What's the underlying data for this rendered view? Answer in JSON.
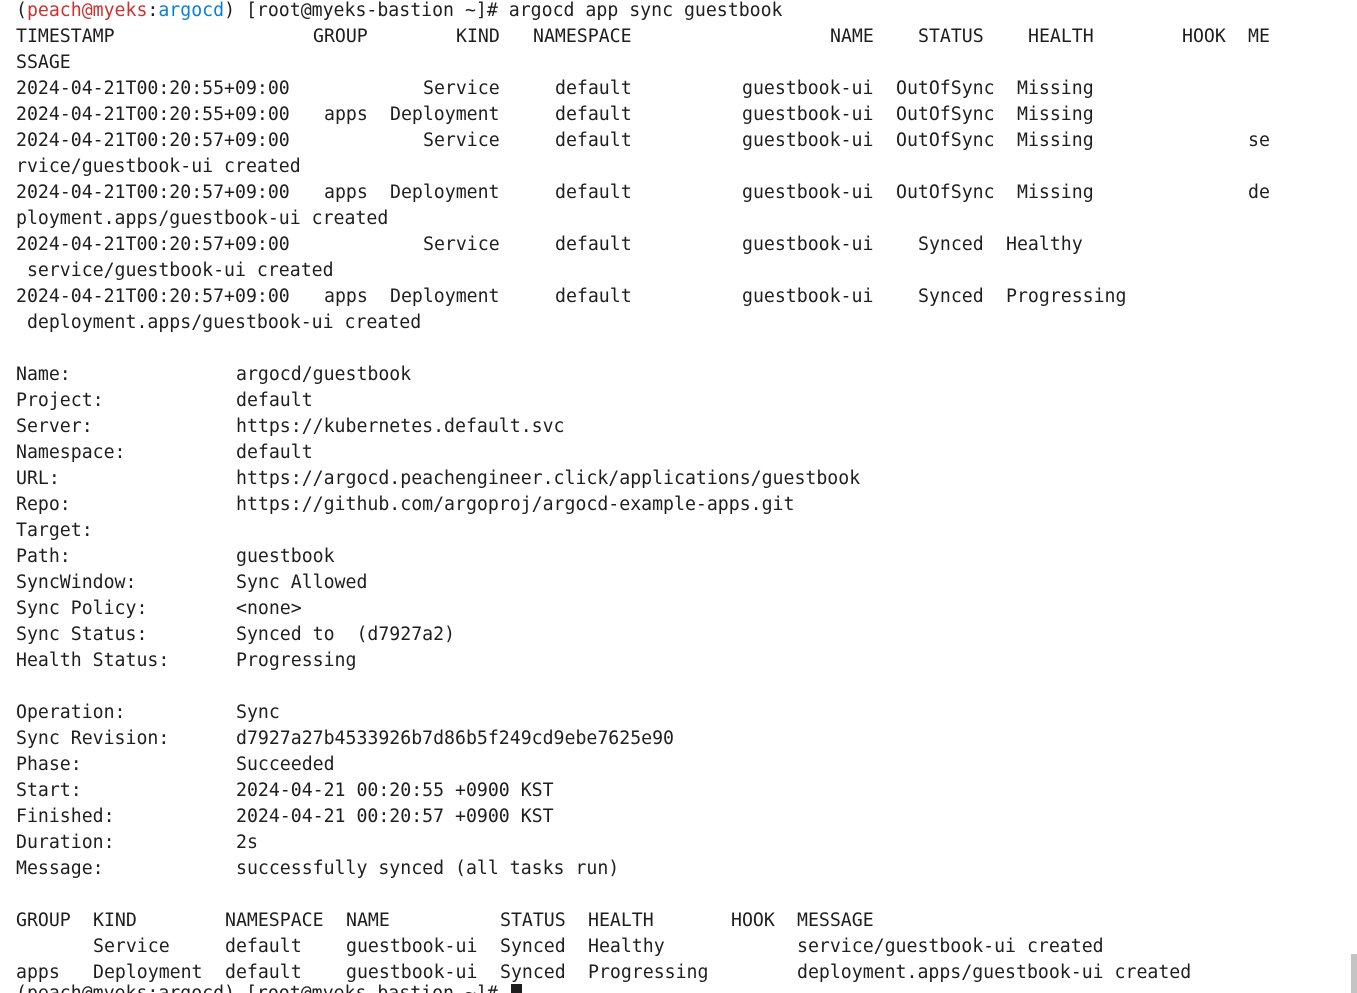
{
  "prompt": {
    "open_paren": "(",
    "user": "peach@myeks",
    "colon": ":",
    "context": "argocd",
    "rest": ") [root@myeks-bastion ~]# ",
    "command": "argocd app sync guestbook",
    "partial_next": "(peach@myeks:argocd) [root@myeks-bastion ~]# "
  },
  "sync_log": {
    "headers": [
      "TIMESTAMP",
      "GROUP",
      "KIND",
      "NAMESPACE",
      "NAME",
      "STATUS",
      "HEALTH",
      "HOOK",
      "ME"
    ],
    "header_wrap": "SSAGE",
    "rows": [
      {
        "timestamp": "2024-04-21T00:20:55+09:00",
        "group": "",
        "kind": "Service",
        "namespace": "default",
        "name": "guestbook-ui",
        "status": "OutOfSync",
        "health": "Missing",
        "message": "",
        "wrap": ""
      },
      {
        "timestamp": "2024-04-21T00:20:55+09:00",
        "group": "apps",
        "kind": "Deployment",
        "namespace": "default",
        "name": "guestbook-ui",
        "status": "OutOfSync",
        "health": "Missing",
        "message": "",
        "wrap": ""
      },
      {
        "timestamp": "2024-04-21T00:20:57+09:00",
        "group": "",
        "kind": "Service",
        "namespace": "default",
        "name": "guestbook-ui",
        "status": "OutOfSync",
        "health": "Missing",
        "message": "se",
        "wrap": "rvice/guestbook-ui created"
      },
      {
        "timestamp": "2024-04-21T00:20:57+09:00",
        "group": "apps",
        "kind": "Deployment",
        "namespace": "default",
        "name": "guestbook-ui",
        "status": "OutOfSync",
        "health": "Missing",
        "message": "de",
        "wrap": "ployment.apps/guestbook-ui created"
      },
      {
        "timestamp": "2024-04-21T00:20:57+09:00",
        "group": "",
        "kind": "Service",
        "namespace": "default",
        "name": "guestbook-ui",
        "status": "Synced",
        "health": "Healthy",
        "message": "",
        "wrap": " service/guestbook-ui created"
      },
      {
        "timestamp": "2024-04-21T00:20:57+09:00",
        "group": "apps",
        "kind": "Deployment",
        "namespace": "default",
        "name": "guestbook-ui",
        "status": "Synced",
        "health": "Progressing",
        "message": "",
        "wrap": " deployment.apps/guestbook-ui created"
      }
    ]
  },
  "app_info": [
    {
      "label": "Name:",
      "value": "argocd/guestbook"
    },
    {
      "label": "Project:",
      "value": "default"
    },
    {
      "label": "Server:",
      "value": "https://kubernetes.default.svc"
    },
    {
      "label": "Namespace:",
      "value": "default"
    },
    {
      "label": "URL:",
      "value": "https://argocd.peachengineer.click/applications/guestbook"
    },
    {
      "label": "Repo:",
      "value": "https://github.com/argoproj/argocd-example-apps.git"
    },
    {
      "label": "Target:",
      "value": ""
    },
    {
      "label": "Path:",
      "value": "guestbook"
    },
    {
      "label": "SyncWindow:",
      "value": "Sync Allowed"
    },
    {
      "label": "Sync Policy:",
      "value": "<none>"
    },
    {
      "label": "Sync Status:",
      "value": "Synced to  (d7927a2)"
    },
    {
      "label": "Health Status:",
      "value": "Progressing"
    }
  ],
  "operation_info": [
    {
      "label": "Operation:",
      "value": "Sync"
    },
    {
      "label": "Sync Revision:",
      "value": "d7927a27b4533926b7d86b5f249cd9ebe7625e90"
    },
    {
      "label": "Phase:",
      "value": "Succeeded"
    },
    {
      "label": "Start:",
      "value": "2024-04-21 00:20:55 +0900 KST"
    },
    {
      "label": "Finished:",
      "value": "2024-04-21 00:20:57 +0900 KST"
    },
    {
      "label": "Duration:",
      "value": "2s"
    },
    {
      "label": "Message:",
      "value": "successfully synced (all tasks run)"
    }
  ],
  "result_table": {
    "headers": [
      "GROUP",
      "KIND",
      "NAMESPACE",
      "NAME",
      "STATUS",
      "HEALTH",
      "HOOK",
      "MESSAGE"
    ],
    "rows": [
      {
        "group": "",
        "kind": "Service",
        "namespace": "default",
        "name": "guestbook-ui",
        "status": "Synced",
        "health": "Healthy",
        "hook": "",
        "message": "service/guestbook-ui created"
      },
      {
        "group": "apps",
        "kind": "Deployment",
        "namespace": "default",
        "name": "guestbook-ui",
        "status": "Synced",
        "health": "Progressing",
        "hook": "",
        "message": "deployment.apps/guestbook-ui created"
      }
    ]
  },
  "colors": {
    "background": "#ffffff",
    "text": "#1e1e1e",
    "prompt_user": "#cd3131",
    "prompt_context": "#0a7fd0"
  }
}
